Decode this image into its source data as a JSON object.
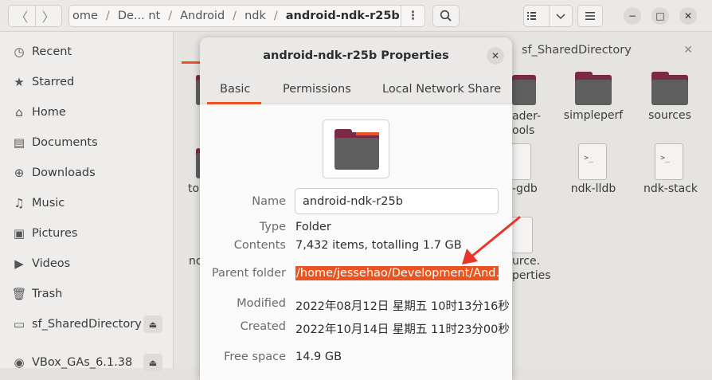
{
  "header": {
    "nav_back": "〈",
    "nav_forward": "〉",
    "path": [
      "Home",
      "De... nt",
      "Android",
      "ndk",
      "android-ndk-r25b"
    ],
    "path_partial_first": "ome",
    "menu_label": "⋮",
    "search_icon": "search-icon",
    "view_list_icon": "list-view-icon",
    "view_dropdown_icon": "chevron-down-icon",
    "hamburger_icon": "hamburger-icon",
    "minimize": "−",
    "maximize": "□",
    "close": "✕"
  },
  "sidebar": {
    "items": [
      {
        "label": "Recent",
        "icon": "clock-icon"
      },
      {
        "label": "Starred",
        "icon": "star-icon"
      },
      {
        "label": "Home",
        "icon": "home-icon"
      },
      {
        "label": "Documents",
        "icon": "document-icon"
      },
      {
        "label": "Downloads",
        "icon": "download-icon"
      },
      {
        "label": "Music",
        "icon": "music-icon"
      },
      {
        "label": "Pictures",
        "icon": "picture-icon"
      },
      {
        "label": "Videos",
        "icon": "video-icon"
      },
      {
        "label": "Trash",
        "icon": "trash-icon"
      },
      {
        "label": "sf_SharedDirectory",
        "icon": "drive-icon"
      },
      {
        "label": "VBox_GAs_6.1.38",
        "icon": "disc-icon"
      }
    ],
    "eject_symbol": "⏏"
  },
  "background": {
    "tab_label": "sf_SharedDirectory",
    "tab_close": "✕",
    "files": [
      {
        "label": "ader-\nools"
      },
      {
        "label": "simpleperf"
      },
      {
        "label": "sources"
      },
      {
        "label": "-gdb"
      },
      {
        "label": "ndk-lldb"
      },
      {
        "label": "ndk-stack"
      },
      {
        "label": "urce.\nperties"
      },
      {
        "label": "to"
      },
      {
        "label": "nd"
      }
    ]
  },
  "dialog": {
    "title": "android-ndk-r25b Properties",
    "close": "✕",
    "tabs": [
      "Basic",
      "Permissions",
      "Local Network Share"
    ],
    "name_label": "Name",
    "name_value": "android-ndk-r25b",
    "type_label": "Type",
    "type_value": "Folder",
    "contents_label": "Contents",
    "contents_value": "7,432 items, totalling 1.7 GB",
    "parent_label": "Parent folder",
    "parent_value": "/home/jessehao/Development/And…",
    "modified_label": "Modified",
    "modified_value": "2022年08月12日 星期五 10时13分16秒",
    "created_label": "Created",
    "created_value": "2022年10月14日 星期五 11时23分00秒",
    "free_label": "Free space",
    "free_value": "14.9 GB"
  },
  "colors": {
    "accent": "#e95420",
    "folder_tab": "#7a2a43",
    "folder_body": "#5e5e5e",
    "arrow": "#e8362b"
  }
}
